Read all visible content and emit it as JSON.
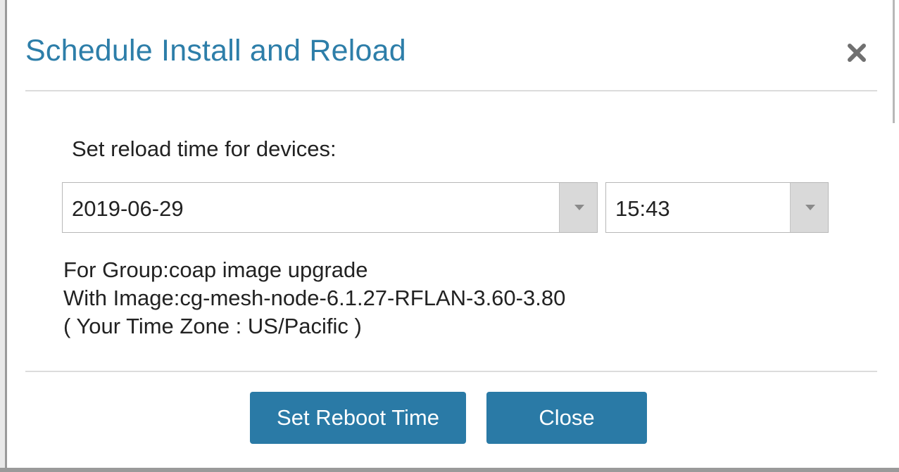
{
  "dialog": {
    "title": "Schedule Install and Reload",
    "close_icon": "close-icon"
  },
  "form": {
    "prompt": "Set reload time for devices:",
    "date_select": {
      "value": "2019-06-29",
      "icon": "chevron-down-icon"
    },
    "time_select": {
      "value": "15:43",
      "icon": "chevron-down-icon"
    }
  },
  "info": {
    "group_line": "For Group:coap image upgrade",
    "image_line": "With Image:cg-mesh-node-6.1.27-RFLAN-3.60-3.80",
    "timezone_line": "( Your Time Zone : US/Pacific )"
  },
  "buttons": {
    "set_reboot_label": "Set Reboot Time",
    "close_label": "Close"
  },
  "colors": {
    "title": "#2d7ea9",
    "button_bg": "#2a7aa6",
    "button_text": "#ffffff",
    "arrow_bg": "#d9d9d9",
    "text": "#222222"
  }
}
